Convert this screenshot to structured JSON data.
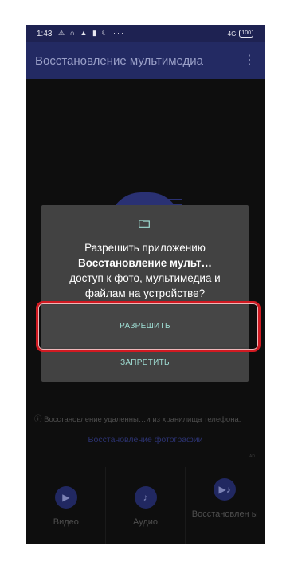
{
  "status_bar": {
    "time": "1:43",
    "icons_text": "⚠ ∩ ▲ ▮ ☾ ···",
    "network": "4G",
    "battery": "100"
  },
  "app_bar": {
    "title": "Восстановление мультимедиа",
    "menu_icon": "more-vert-icon"
  },
  "dialog": {
    "icon": "folder-icon",
    "line1": "Разрешить приложению",
    "app_name": "Восстановление мульт…",
    "line3": "доступ к фото, мультимедиа и",
    "line4": "файлам на устройстве?",
    "allow": "РАЗРЕШИТЬ",
    "deny": "ЗАПРЕТИТЬ"
  },
  "background": {
    "notice": "Восстановление удаленны…и из хранилища телефона.",
    "recover_photos": "Восстановление фотографии",
    "ad_label": "AD",
    "tiles": [
      {
        "label": "Видео",
        "icon": "video-icon"
      },
      {
        "label": "Аудио",
        "icon": "music-icon"
      },
      {
        "label": "Восстановлен ы",
        "icon": "restored-icon"
      }
    ]
  },
  "colors": {
    "app_bar": "#232a63",
    "dialog_bg": "#424242",
    "button_text": "#9edcd2",
    "highlight": "#d11a22"
  }
}
